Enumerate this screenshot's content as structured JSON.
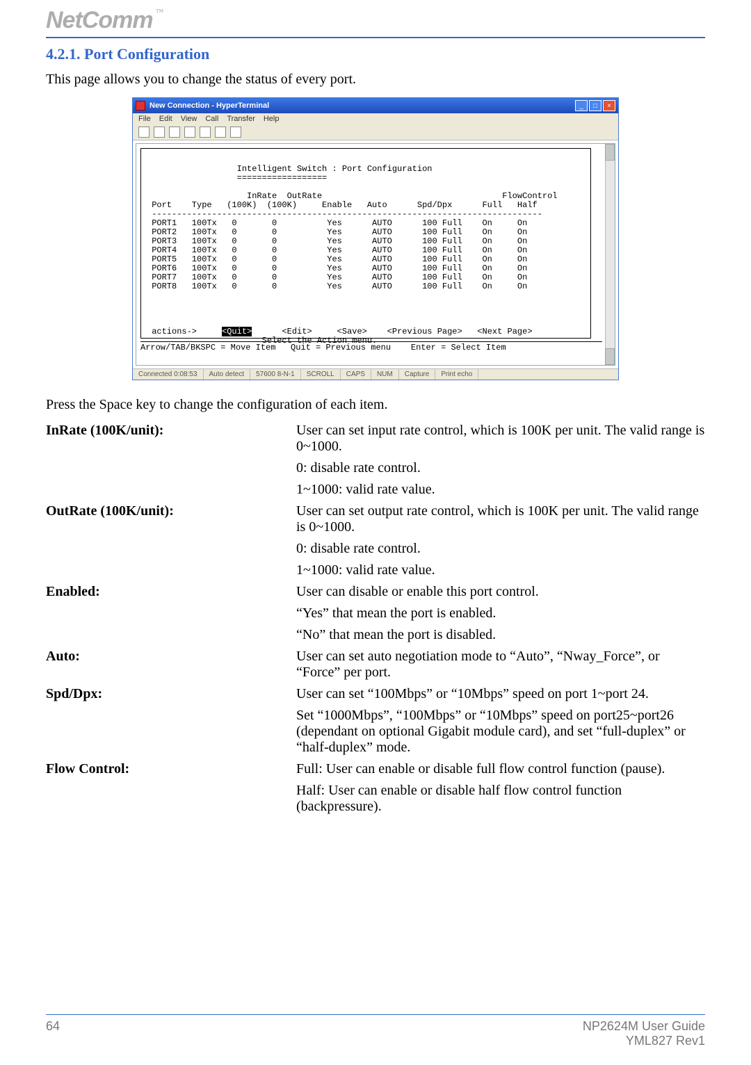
{
  "brand": {
    "logo": "NetComm",
    "tm": "™"
  },
  "section": {
    "number_title": "4.2.1. Port Configuration"
  },
  "intro": "This page allows you to change the status of every port.",
  "window": {
    "title": "New Connection - HyperTerminal",
    "menus": [
      "File",
      "Edit",
      "View",
      "Call",
      "Transfer",
      "Help"
    ],
    "status": {
      "connected": "Connected 0:08:53",
      "auto": "Auto detect",
      "baud": "57600 8-N-1",
      "f1": "SCROLL",
      "f2": "CAPS",
      "f3": "NUM",
      "f4": "Capture",
      "f5": "Print echo"
    },
    "terminal": {
      "heading": "Intelligent Switch : Port Configuration",
      "hrule": "==================",
      "cols": {
        "port": "Port",
        "type": "Type",
        "inrate": "InRate",
        "inrate2": "(100K)",
        "outrate": "OutRate",
        "outrate2": "(100K)",
        "enable": "Enable",
        "auto": "Auto",
        "spddpx": "Spd/Dpx",
        "flow": "FlowControl",
        "full": "Full",
        "half": "Half"
      },
      "rows": [
        {
          "port": "PORT1",
          "type": "100Tx",
          "in": "0",
          "out": "0",
          "enable": "Yes",
          "auto": "AUTO",
          "sd": "100 Full",
          "full": "On",
          "half": "On"
        },
        {
          "port": "PORT2",
          "type": "100Tx",
          "in": "0",
          "out": "0",
          "enable": "Yes",
          "auto": "AUTO",
          "sd": "100 Full",
          "full": "On",
          "half": "On"
        },
        {
          "port": "PORT3",
          "type": "100Tx",
          "in": "0",
          "out": "0",
          "enable": "Yes",
          "auto": "AUTO",
          "sd": "100 Full",
          "full": "On",
          "half": "On"
        },
        {
          "port": "PORT4",
          "type": "100Tx",
          "in": "0",
          "out": "0",
          "enable": "Yes",
          "auto": "AUTO",
          "sd": "100 Full",
          "full": "On",
          "half": "On"
        },
        {
          "port": "PORT5",
          "type": "100Tx",
          "in": "0",
          "out": "0",
          "enable": "Yes",
          "auto": "AUTO",
          "sd": "100 Full",
          "full": "On",
          "half": "On"
        },
        {
          "port": "PORT6",
          "type": "100Tx",
          "in": "0",
          "out": "0",
          "enable": "Yes",
          "auto": "AUTO",
          "sd": "100 Full",
          "full": "On",
          "half": "On"
        },
        {
          "port": "PORT7",
          "type": "100Tx",
          "in": "0",
          "out": "0",
          "enable": "Yes",
          "auto": "AUTO",
          "sd": "100 Full",
          "full": "On",
          "half": "On"
        },
        {
          "port": "PORT8",
          "type": "100Tx",
          "in": "0",
          "out": "0",
          "enable": "Yes",
          "auto": "AUTO",
          "sd": "100 Full",
          "full": "On",
          "half": "On"
        }
      ],
      "actions_label": "actions->",
      "actions": {
        "quit": "<Quit>",
        "edit": "<Edit>",
        "save": "<Save>",
        "prev": "<Previous Page>",
        "next": "<Next Page>"
      },
      "action_hint": "Select the Action menu.",
      "helpline": "Arrow/TAB/BKSPC = Move Item   Quit = Previous menu    Enter = Select Item"
    }
  },
  "midtext": "Press the Space key to change the configuration of each item.",
  "defs": [
    {
      "term": "InRate (100K/unit):",
      "paras": [
        "User can set input rate control, which is 100K per unit.  The valid range is 0~1000.",
        "0: disable rate control.",
        "1~1000: valid rate value."
      ]
    },
    {
      "term": "OutRate (100K/unit):",
      "paras": [
        "User can set output rate control, which is 100K per unit.  The valid range is 0~1000.",
        "0: disable rate control.",
        "1~1000: valid rate value."
      ]
    },
    {
      "term": "Enabled:",
      "paras": [
        "User can disable or enable this port control.",
        "“Yes” that mean the port is enabled.",
        "“No” that mean the port is disabled."
      ]
    },
    {
      "term": "Auto:",
      "paras": [
        "User can set auto negotiation mode to “Auto”, “Nway_Force”, or “Force” per port."
      ]
    },
    {
      "term": "Spd/Dpx:",
      "paras": [
        "User can set “100Mbps” or “10Mbps” speed on port 1~port 24.",
        "Set “1000Mbps”, “100Mbps” or “10Mbps” speed on port25~port26 (dependant on optional Gigabit module card), and set “full-duplex” or “half-duplex” mode."
      ]
    },
    {
      "term": "Flow Control:",
      "paras": [
        "Full: User can enable or disable full flow control function (pause).",
        "Half: User can enable or disable half flow control function (backpressure)."
      ]
    }
  ],
  "footer": {
    "page": "64",
    "guide": "NP2624M User Guide",
    "rev": "YML827 Rev1"
  },
  "chart_data": {
    "type": "table",
    "title": "Intelligent Switch : Port Configuration",
    "columns": [
      "Port",
      "Type",
      "InRate (100K)",
      "OutRate (100K)",
      "Enable",
      "Auto",
      "Spd/Dpx",
      "FlowControl Full",
      "FlowControl Half"
    ],
    "rows": [
      [
        "PORT1",
        "100Tx",
        0,
        0,
        "Yes",
        "AUTO",
        "100 Full",
        "On",
        "On"
      ],
      [
        "PORT2",
        "100Tx",
        0,
        0,
        "Yes",
        "AUTO",
        "100 Full",
        "On",
        "On"
      ],
      [
        "PORT3",
        "100Tx",
        0,
        0,
        "Yes",
        "AUTO",
        "100 Full",
        "On",
        "On"
      ],
      [
        "PORT4",
        "100Tx",
        0,
        0,
        "Yes",
        "AUTO",
        "100 Full",
        "On",
        "On"
      ],
      [
        "PORT5",
        "100Tx",
        0,
        0,
        "Yes",
        "AUTO",
        "100 Full",
        "On",
        "On"
      ],
      [
        "PORT6",
        "100Tx",
        0,
        0,
        "Yes",
        "AUTO",
        "100 Full",
        "On",
        "On"
      ],
      [
        "PORT7",
        "100Tx",
        0,
        0,
        "Yes",
        "AUTO",
        "100 Full",
        "On",
        "On"
      ],
      [
        "PORT8",
        "100Tx",
        0,
        0,
        "Yes",
        "AUTO",
        "100 Full",
        "On",
        "On"
      ]
    ]
  }
}
